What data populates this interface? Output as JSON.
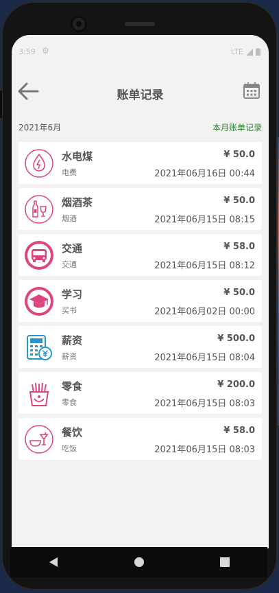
{
  "status": {
    "time": "3:59",
    "network": "LTE"
  },
  "header": {
    "title": "账单记录"
  },
  "subheader": {
    "month": "2021年6月",
    "link": "本月账单记录"
  },
  "records": [
    {
      "icon": "water-electric-coal-icon",
      "name": "水电煤",
      "note": "电费",
      "amount": "¥ 50.0",
      "date": "2021年06月16日 00:44"
    },
    {
      "icon": "tobacco-wine-tea-icon",
      "name": "烟酒茶",
      "note": "烟酒",
      "amount": "¥ 50.0",
      "date": "2021年06月15日 08:15"
    },
    {
      "icon": "bus-icon",
      "name": "交通",
      "note": "交通",
      "amount": "¥ 58.0",
      "date": "2021年06月15日 08:12"
    },
    {
      "icon": "graduation-cap-icon",
      "name": "学习",
      "note": "买书",
      "amount": "¥ 50.0",
      "date": "2021年06月02日 00:00"
    },
    {
      "icon": "salary-calculator-icon",
      "name": "薪资",
      "note": "薪资",
      "amount": "¥ 500.0",
      "date": "2021年06月15日 08:04"
    },
    {
      "icon": "snack-fries-icon",
      "name": "零食",
      "note": "零食",
      "amount": "¥ 200.0",
      "date": "2021年06月15日 08:03"
    },
    {
      "icon": "dining-drink-icon",
      "name": "餐饮",
      "note": "吃饭",
      "amount": "¥ 58.0",
      "date": "2021年06月15日 08:03"
    }
  ],
  "colors": {
    "accent": "#e0447e",
    "salary": "#2196d3",
    "link": "#2e7d32"
  }
}
